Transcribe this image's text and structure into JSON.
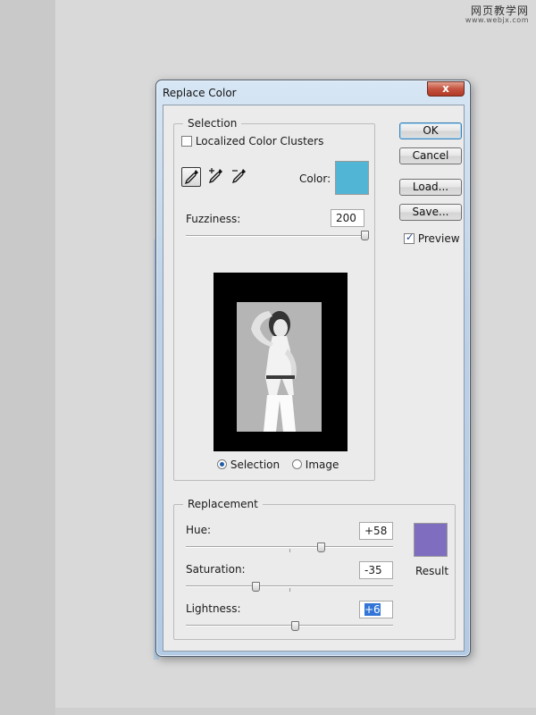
{
  "watermark": {
    "title": "网页教学网",
    "url": "www.webjx.com"
  },
  "dialog": {
    "title": "Replace Color",
    "close_glyph": "x",
    "selection": {
      "legend": "Selection",
      "localized_label": "Localized Color Clusters",
      "localized_checked": false,
      "tools": [
        "eyedropper-icon",
        "eyedropper-plus-icon",
        "eyedropper-minus-icon"
      ],
      "color_label": "Color:",
      "color": "#51b5d6",
      "fuzziness_label": "Fuzziness:",
      "fuzziness_value": "200",
      "fuzziness_fraction": 1.0,
      "view_options": [
        "Selection",
        "Image"
      ],
      "view_selected": "Selection"
    },
    "buttons": {
      "ok": "OK",
      "cancel": "Cancel",
      "load": "Load...",
      "save": "Save..."
    },
    "preview_label": "Preview",
    "preview_checked": true,
    "replacement": {
      "legend": "Replacement",
      "hue_label": "Hue:",
      "hue_value": "+58",
      "hue_fraction": 0.66,
      "saturation_label": "Saturation:",
      "saturation_value": "-35",
      "saturation_fraction": 0.33,
      "lightness_label": "Lightness:",
      "lightness_value": "+6",
      "lightness_fraction": 0.53,
      "result_label": "Result",
      "result_color": "#7f6dbf"
    }
  }
}
